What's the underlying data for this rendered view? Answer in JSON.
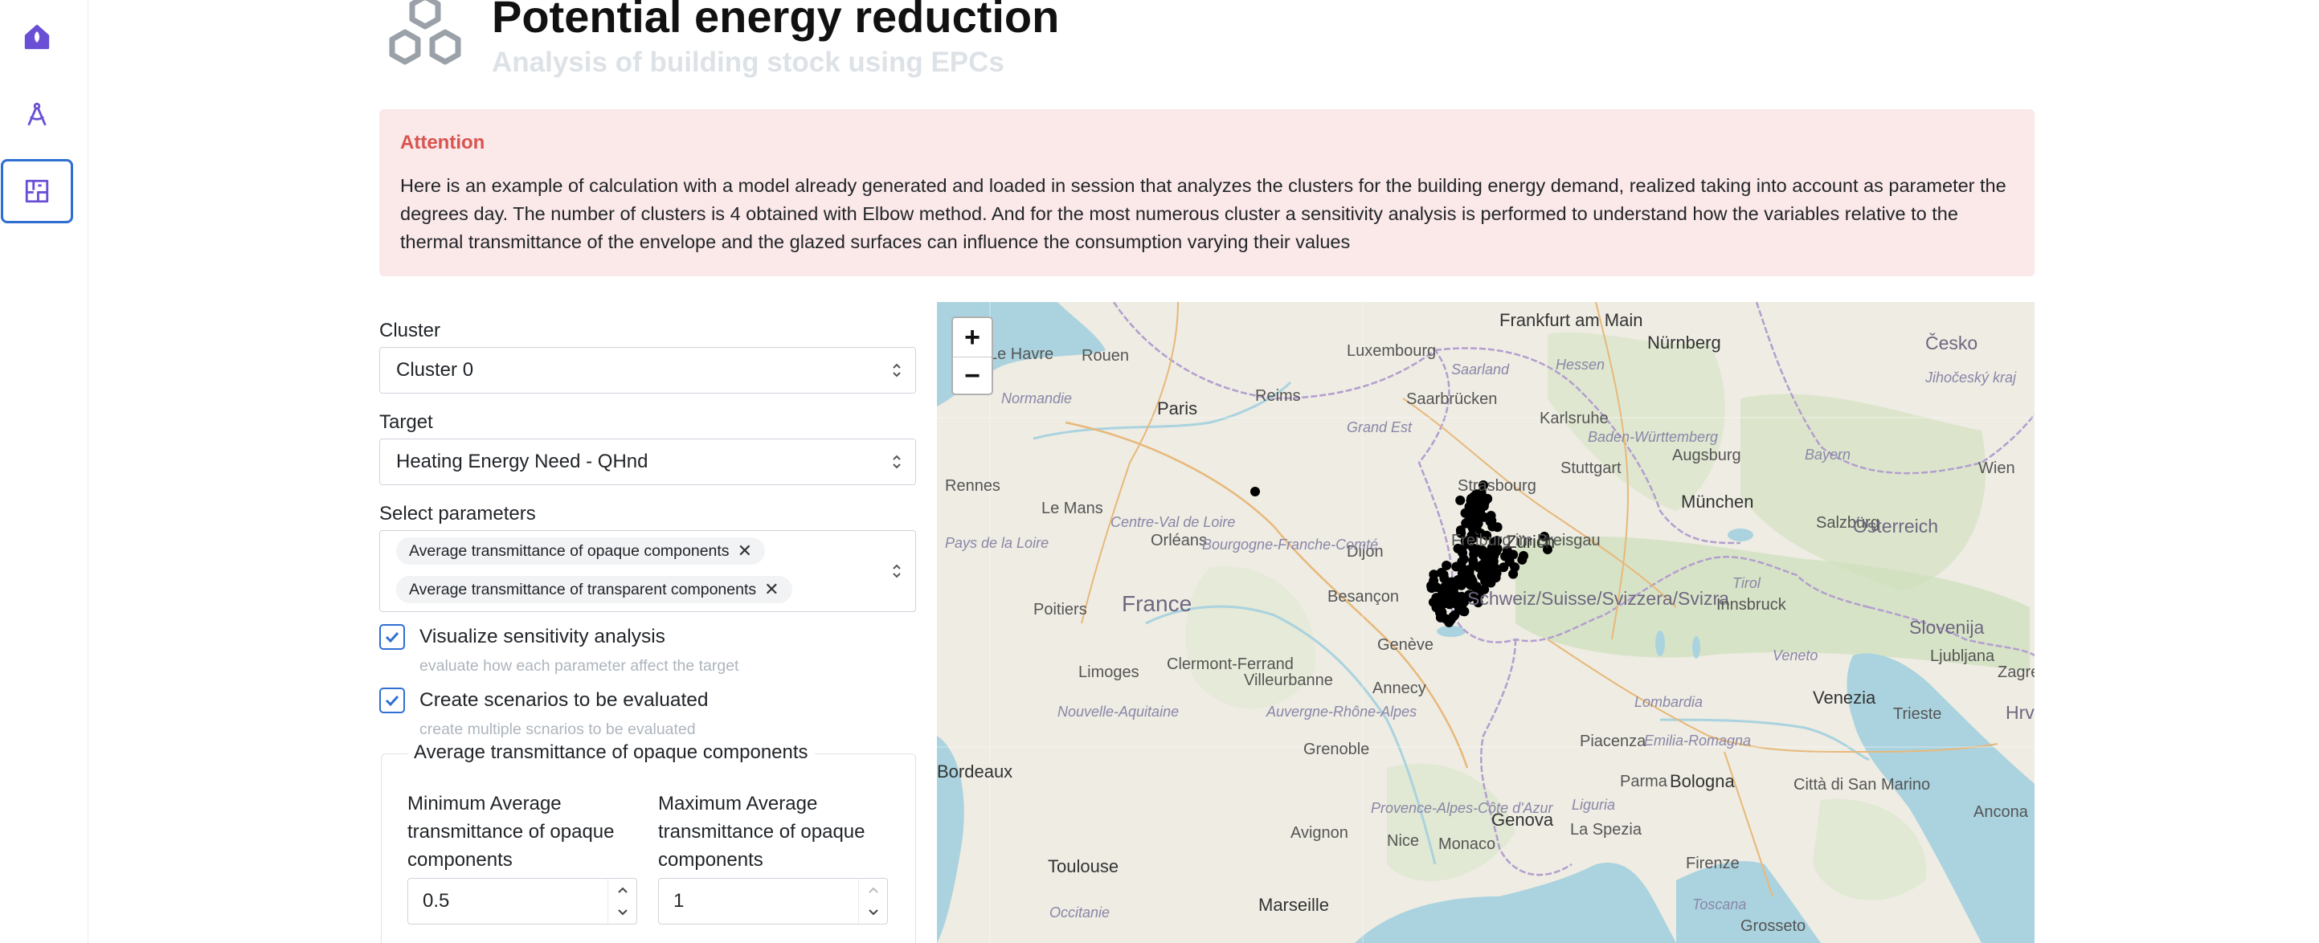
{
  "sidebar": {
    "items": [
      {
        "name": "home",
        "icon": "home-rocket-icon",
        "active": false
      },
      {
        "name": "compass",
        "icon": "compass-icon",
        "active": false
      },
      {
        "name": "floorplan",
        "icon": "floorplan-icon",
        "active": true
      }
    ]
  },
  "header": {
    "title": "Potential energy reduction",
    "subtitle": "Analysis of building stock using EPCs"
  },
  "alert": {
    "title": "Attention",
    "body": "Here is an example of calculation with a model already generated and loaded in session that analyzes the clusters for the building energy demand, realized taking into account as parameter the degrees day. The number of clusters is 4 obtained with Elbow method. And for the most numerous cluster a sensitivity analysis is performed to understand how the variables relative to the thermal transmittance of the envelope and the glazed surfaces can influence the consumption varying their values"
  },
  "form": {
    "cluster": {
      "label": "Cluster",
      "value": "Cluster 0"
    },
    "target": {
      "label": "Target",
      "value": "Heating Energy Need - QHnd"
    },
    "parameters": {
      "label": "Select parameters",
      "selected": [
        "Average transmittance of opaque components",
        "Average transmittance of transparent components"
      ]
    },
    "sensitivity": {
      "label": "Visualize sensitivity analysis",
      "hint": "evaluate how each parameter affect the target",
      "checked": true
    },
    "scenarios": {
      "label": "Create scenarios to be evaluated",
      "hint": "create multiple scnarios to be evaluated",
      "checked": true
    },
    "opaque_group": {
      "legend": "Average transmittance of opaque components",
      "min_label": "Minimum Average transmittance of opaque components",
      "min_value": "0.5",
      "max_label": "Maximum Average transmittance of opaque components",
      "max_value": "1"
    }
  },
  "map": {
    "zoom_in": "+",
    "zoom_out": "−",
    "countries": [
      "France",
      "Slovenija",
      "Hrvatska"
    ],
    "cities": [
      "Le Havre",
      "Rouen",
      "Paris",
      "Reims",
      "Luxembourg",
      "Frankfurt am Main",
      "Saarbrücken",
      "Karlsruhe",
      "Nürnberg",
      "Česko",
      "Stuttgart",
      "Augsburg",
      "Strasbourg",
      "Rennes",
      "Le Mans",
      "Orléans",
      "Dijon",
      "Freiburg im Breisgau",
      "Zürich",
      "München",
      "Salzburg",
      "Österreich",
      "Wien",
      "Poitiers",
      "Besançon",
      "Schweiz/Suisse/Svizzera/Svizra",
      "Innsbruck",
      "Limoges",
      "Clermont-Ferrand",
      "Villeurbanne",
      "Annecy",
      "Genève",
      "Grenoble",
      "Piacenza",
      "Parma",
      "Bologna",
      "Venezia",
      "Trieste",
      "Ljubljana",
      "Zagreb",
      "Nice",
      "Monaco",
      "Genova",
      "La Spezia",
      "Firenze",
      "Toulouse",
      "Avignon",
      "Marseille",
      "Città di San Marino",
      "Grosseto",
      "Bordeaux",
      "Ancona"
    ],
    "regions": [
      "Normandie",
      "Grand Est",
      "Saarland",
      "Hessen",
      "Baden-Württemberg",
      "Bayern",
      "Pays de la Loire",
      "Centre-Val de Loire",
      "Bourgogne-Franche-Comté",
      "Nouvelle-Aquitaine",
      "Auvergne-Rhône-Alpes",
      "Lombardia",
      "Emilia-Romagna",
      "Provence-Alpes-Côte d'Azur",
      "Occitanie",
      "Toscana",
      "Liguria",
      "Veneto",
      "Tirol",
      "Jihočeský kraj"
    ],
    "marker_count": 180
  },
  "colors": {
    "accent": "#2f6fd1",
    "sidebar_icon": "#6a4fd6",
    "alert_bg": "#fbe8e8",
    "alert_title": "#d9534f",
    "marker": "#000000"
  }
}
